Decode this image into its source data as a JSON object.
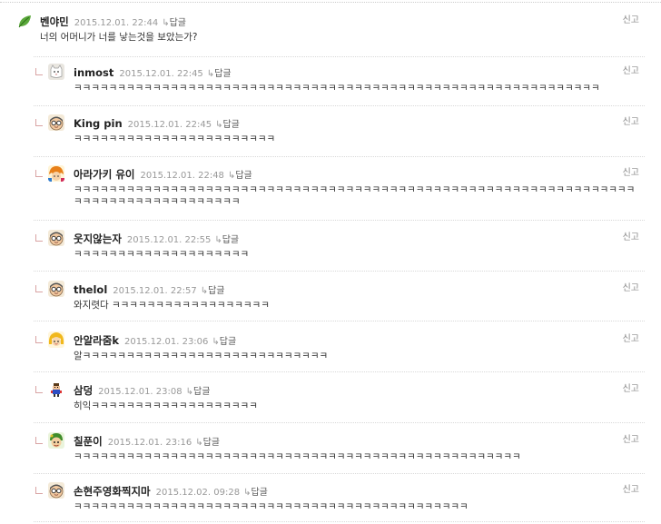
{
  "root": {
    "nick": "벤야민",
    "date": "2015.12.01. 22:44",
    "reply": "답글",
    "report": "신고",
    "text": "너의 어머니가 너를 낳는것을 보았는가?",
    "avatar": "leaf-icon"
  },
  "replies": [
    {
      "nick": "inmost",
      "date": "2015.12.01. 22:45",
      "reply": "답글",
      "report": "신고",
      "text": "ㅋㅋㅋㅋㅋㅋㅋㅋㅋㅋㅋㅋㅋㅋㅋㅋㅋㅋㅋㅋㅋㅋㅋㅋㅋㅋㅋㅋㅋㅋㅋㅋㅋㅋㅋㅋㅋㅋㅋㅋㅋㅋㅋㅋㅋㅋㅋㅋㅋㅋㅋㅋㅋㅋㅋㅋㅋㅋㅋㅋ",
      "avatar": "white-cat-icon"
    },
    {
      "nick": "King pin",
      "date": "2015.12.01. 22:45",
      "reply": "답글",
      "report": "신고",
      "text": "ㅋㅋㅋㅋㅋㅋㅋㅋㅋㅋㅋㅋㅋㅋㅋㅋㅋㅋㅋㅋㅋㅋㅋ",
      "avatar": "glasses-face-icon"
    },
    {
      "nick": "아라가키 유이",
      "date": "2015.12.01. 22:48",
      "reply": "답글",
      "report": "신고",
      "text": "ㅋㅋㅋㅋㅋㅋㅋㅋㅋㅋㅋㅋㅋㅋㅋㅋㅋㅋㅋㅋㅋㅋㅋㅋㅋㅋㅋㅋㅋㅋㅋㅋㅋㅋㅋㅋㅋㅋㅋㅋㅋㅋㅋㅋㅋㅋㅋㅋㅋㅋㅋㅋㅋㅋㅋㅋㅋㅋㅋㅋㅋㅋㅋㅋㅋㅋㅋㅋㅋㅋㅋㅋㅋㅋㅋㅋㅋㅋㅋㅋㅋㅋㅋ",
      "avatar": "colorful-character-icon"
    },
    {
      "nick": "웃지않는자",
      "date": "2015.12.01. 22:55",
      "reply": "답글",
      "report": "신고",
      "text": "ㅋㅋㅋㅋㅋㅋㅋㅋㅋㅋㅋㅋㅋㅋㅋㅋㅋㅋㅋㅋ",
      "avatar": "glasses-face-icon"
    },
    {
      "nick": "thelol",
      "date": "2015.12.01. 22:57",
      "reply": "답글",
      "report": "신고",
      "text": "와지렷다 ㅋㅋㅋㅋㅋㅋㅋㅋㅋㅋㅋㅋㅋㅋㅋㅋㅋㅋ",
      "avatar": "glasses-face-icon"
    },
    {
      "nick": "안알라줌k",
      "date": "2015.12.01. 23:06",
      "reply": "답글",
      "report": "신고",
      "text": "알ㅋㅋㅋㅋㅋㅋㅋㅋㅋㅋㅋㅋㅋㅋㅋㅋㅋㅋㅋㅋㅋㅋㅋㅋㅋㅋㅋㅋ",
      "avatar": "yellow-girl-icon"
    },
    {
      "nick": "삼덩",
      "date": "2015.12.01. 23:08",
      "reply": "답글",
      "report": "신고",
      "text": "히익ㅋㅋㅋㅋㅋㅋㅋㅋㅋㅋㅋㅋㅋㅋㅋㅋㅋㅋㅋ",
      "avatar": "pixel-character-icon"
    },
    {
      "nick": "칠푼이",
      "date": "2015.12.01. 23:16",
      "reply": "답글",
      "report": "신고",
      "text": "ㅋㅋㅋㅋㅋㅋㅋㅋㅋㅋㅋㅋㅋㅋㅋㅋㅋㅋㅋㅋㅋㅋㅋㅋㅋㅋㅋㅋㅋㅋㅋㅋㅋㅋㅋㅋㅋㅋㅋㅋㅋㅋㅋㅋㅋㅋㅋㅋㅋㅋㅋ",
      "avatar": "green-character-icon"
    },
    {
      "nick": "손현주영화찍지마",
      "date": "2015.12.02. 09:28",
      "reply": "답글",
      "report": "신고",
      "text": "ㅋㅋㅋㅋㅋㅋㅋㅋㅋㅋㅋㅋㅋㅋㅋㅋㅋㅋㅋㅋㅋㅋㅋㅋㅋㅋㅋㅋㅋㅋㅋㅋㅋㅋㅋㅋㅋㅋㅋㅋㅋㅋㅋㅋㅋ",
      "avatar": "glasses-face-icon"
    }
  ]
}
